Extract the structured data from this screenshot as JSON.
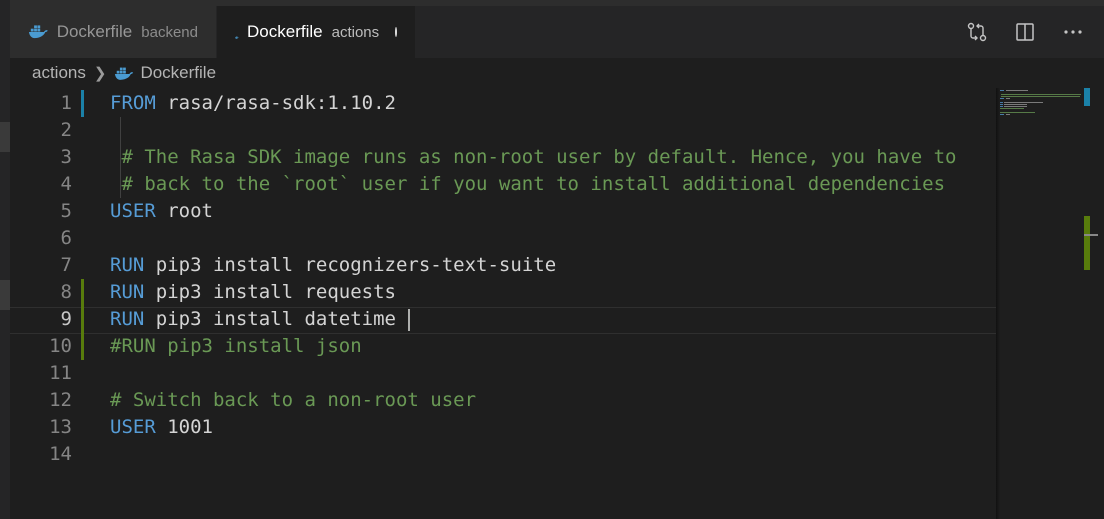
{
  "tabs": [
    {
      "label": "Dockerfile",
      "description": "backend",
      "active": false,
      "dirty": false
    },
    {
      "label": "Dockerfile",
      "description": "actions",
      "active": true,
      "dirty": true
    }
  ],
  "tab_actions": [
    "source-control-compare-icon",
    "split-editor-icon",
    "more-actions-icon"
  ],
  "breadcrumb": {
    "folder": "actions",
    "file": "Dockerfile"
  },
  "editor": {
    "current_line": 9,
    "lines": [
      {
        "n": "1",
        "parts": [
          {
            "t": "FROM",
            "c": "kw"
          },
          {
            "t": " rasa/rasa-sdk:1.10.2",
            "c": ""
          }
        ]
      },
      {
        "n": "2",
        "parts": []
      },
      {
        "n": "3",
        "parts": [
          {
            "t": " # The Rasa SDK image runs as non-root user by default. Hence, you have to",
            "c": "cm"
          }
        ]
      },
      {
        "n": "4",
        "parts": [
          {
            "t": " # back to the `root` user if you want to install additional dependencies",
            "c": "cm"
          }
        ]
      },
      {
        "n": "5",
        "parts": [
          {
            "t": "USER",
            "c": "kw"
          },
          {
            "t": " root",
            "c": ""
          }
        ]
      },
      {
        "n": "6",
        "parts": []
      },
      {
        "n": "7",
        "parts": [
          {
            "t": "RUN",
            "c": "kw"
          },
          {
            "t": " pip3 install recognizers-text-suite",
            "c": ""
          }
        ]
      },
      {
        "n": "8",
        "parts": [
          {
            "t": "RUN",
            "c": "kw"
          },
          {
            "t": " pip3 install requests",
            "c": ""
          }
        ]
      },
      {
        "n": "9",
        "parts": [
          {
            "t": "RUN",
            "c": "kw"
          },
          {
            "t": " pip3 install datetime",
            "c": ""
          }
        ]
      },
      {
        "n": "10",
        "parts": [
          {
            "t": "#RUN pip3 install json",
            "c": "cm"
          }
        ]
      },
      {
        "n": "11",
        "parts": []
      },
      {
        "n": "12",
        "parts": [
          {
            "t": "# Switch back to a non-root user",
            "c": "cm"
          }
        ]
      },
      {
        "n": "13",
        "parts": [
          {
            "t": "USER",
            "c": "kw"
          },
          {
            "t": " 1001",
            "c": ""
          }
        ]
      },
      {
        "n": "14",
        "parts": []
      }
    ],
    "git_changes": [
      {
        "line": 1,
        "kind": "modified"
      },
      {
        "line": 8,
        "kind": "added"
      },
      {
        "line": 9,
        "kind": "added"
      },
      {
        "line": 10,
        "kind": "added"
      }
    ]
  },
  "colors": {
    "keyword": "#569cd6",
    "comment": "#6a9955",
    "modified": "#1b81a8",
    "added": "#587c0c"
  }
}
